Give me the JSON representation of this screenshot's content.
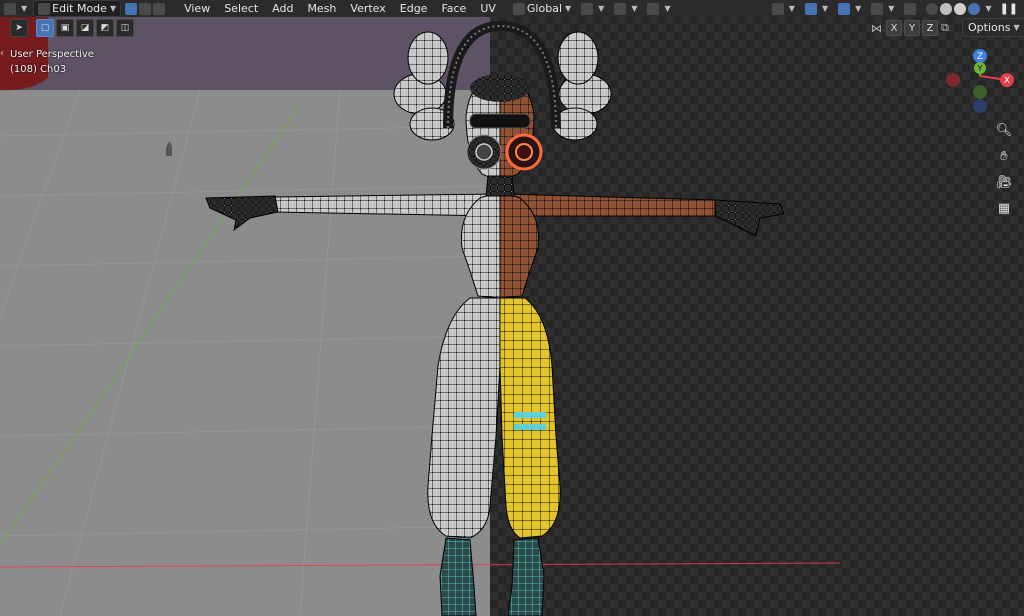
{
  "header": {
    "mode_label": "Edit Mode",
    "menus": [
      "View",
      "Select",
      "Add",
      "Mesh",
      "Vertex",
      "Edge",
      "Face",
      "UV"
    ],
    "transform_orientation": "Global"
  },
  "viewport": {
    "perspective_label": "User Perspective",
    "object_label": "(108) Ch03"
  },
  "mirror_axes": [
    "X",
    "Y",
    "Z"
  ],
  "options_label": "Options",
  "gizmo_axes": {
    "z": "Z",
    "y": "Y",
    "x": "X"
  },
  "colors": {
    "accent_blue": "#4772b3",
    "axis_x": "#e0404b",
    "axis_y": "#6ab53b",
    "axis_z": "#3f7fe0",
    "mesh_gray": "#cfcfcf",
    "mesh_skin": "#9a5a3c",
    "mesh_yellow": "#e6c72e"
  },
  "icons": [
    "editor-type-icon",
    "mode-icon",
    "select-mode-vertex-icon",
    "select-mode-edge-icon",
    "select-mode-face-icon",
    "pivot-icon",
    "snap-icon",
    "proportional-icon",
    "overlay-icon",
    "xray-icon",
    "shading-wireframe-icon",
    "shading-solid-icon",
    "shading-material-icon",
    "shading-rendered-icon",
    "zoom-icon",
    "hand-pan-icon",
    "camera-icon",
    "grid-icon"
  ]
}
